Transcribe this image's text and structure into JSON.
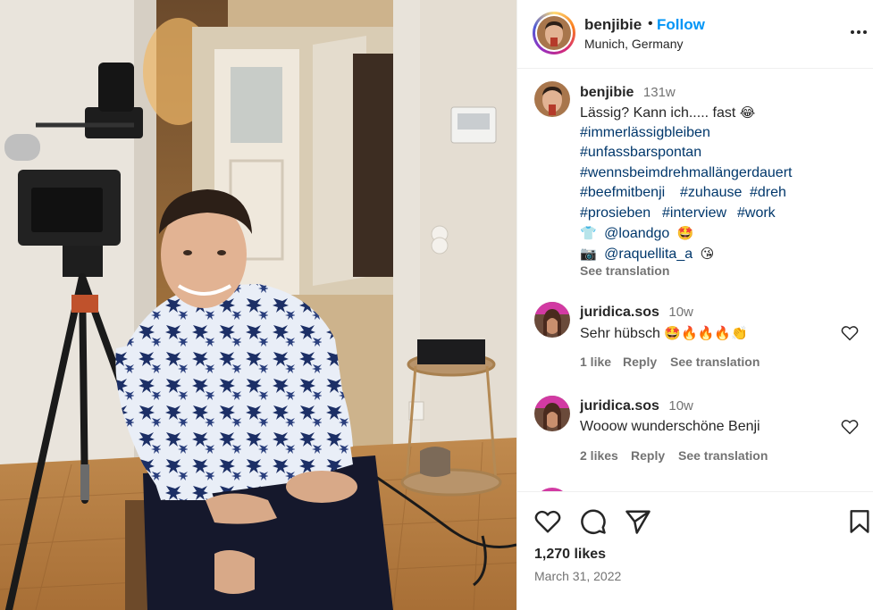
{
  "post": {
    "username": "benjibie",
    "follow_label": "Follow",
    "separator": "•",
    "location": "Munich, Germany"
  },
  "caption": {
    "username": "benjibie",
    "age": "131w",
    "text": "Lässig? Kann ich..... fast",
    "emoji_text": "😂",
    "hashtags": [
      "#immerlässigbleiben",
      "#unfassbarspontan",
      "#wennsbeimdrehmallängerdauert",
      "#beefmitbenji",
      "#zuhause",
      "#dreh",
      "#prosieben",
      "#interview",
      "#work"
    ],
    "credit_1": {
      "icon": "👕",
      "handle": "@loandgo",
      "emoji": "🤩"
    },
    "credit_2": {
      "icon": "📷",
      "handle": "@raquellita_a",
      "emoji": "😘"
    },
    "see_translation": "See translation"
  },
  "comments": [
    {
      "username": "juridica.sos",
      "age": "10w",
      "text": "Sehr hübsch",
      "emojis": "🤩🔥🔥🔥👏",
      "likes": "1 like",
      "reply": "Reply",
      "see_translation": "See translation"
    },
    {
      "username": "juridica.sos",
      "age": "10w",
      "text": "Wooow wunderschöne Benji",
      "likes": "2 likes",
      "reply": "Reply",
      "see_translation": "See translation"
    }
  ],
  "footer": {
    "likes": "1,270 likes",
    "date": "March 31, 2022"
  },
  "colors": {
    "link": "#00376b",
    "follow": "#0095f6",
    "muted": "#737373",
    "text": "#262626"
  },
  "icons": [
    "more-icon",
    "heart-icon",
    "comment-icon",
    "share-icon",
    "bookmark-icon"
  ]
}
